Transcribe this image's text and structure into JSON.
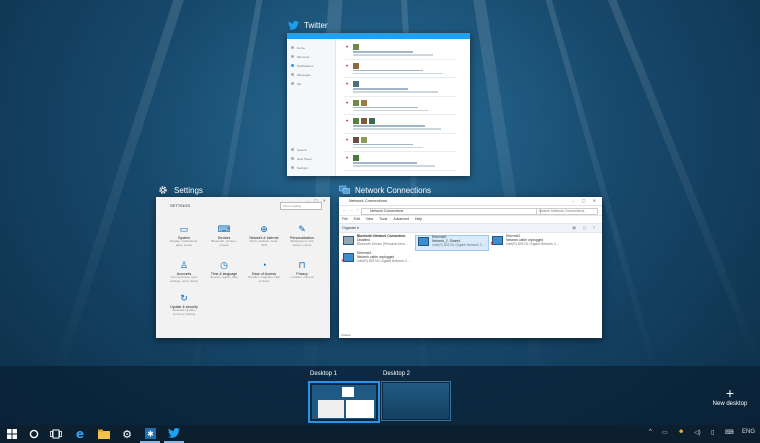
{
  "windows": {
    "twitter": {
      "title": "Twitter",
      "app_bar": "Twitter",
      "nav": [
        "Home",
        "Moments",
        "Notifications",
        "Messages",
        "Me"
      ],
      "nav_bottom": [
        "Search",
        "New Tweet",
        "Settings"
      ]
    },
    "settings": {
      "title": "Settings",
      "heading": "SETTINGS",
      "search_placeholder": "Find a setting",
      "tiles": [
        {
          "name": "System",
          "desc": "Display, notifications, apps, power",
          "icon": "system-icon"
        },
        {
          "name": "Devices",
          "desc": "Bluetooth, printers, mouse",
          "icon": "devices-icon"
        },
        {
          "name": "Network & Internet",
          "desc": "Wi-Fi, airplane mode, VPN",
          "icon": "network-icon"
        },
        {
          "name": "Personalization",
          "desc": "Background, lock screen, colors",
          "icon": "personalization-icon"
        },
        {
          "name": "Accounts",
          "desc": "Your accounts, sync settings, work, family",
          "icon": "accounts-icon"
        },
        {
          "name": "Time & language",
          "desc": "Speech, region, date",
          "icon": "clock-icon"
        },
        {
          "name": "Ease of Access",
          "desc": "Narrator, magnifier, high contrast",
          "icon": "ease-of-access-icon"
        },
        {
          "name": "Privacy",
          "desc": "Location, camera",
          "icon": "lock-icon"
        },
        {
          "name": "Update & security",
          "desc": "Windows Update, recovery, backup",
          "icon": "update-icon"
        }
      ]
    },
    "network": {
      "title": "Network Connections",
      "window_title": "Network Connections",
      "address": "Network Connections",
      "search_placeholder": "Search Network Connections",
      "menu": [
        "File",
        "Edit",
        "View",
        "Tools",
        "Advanced",
        "Help"
      ],
      "organize": "Organize ▾",
      "adapters": [
        {
          "name": "Bluetooth Network Connection",
          "status": "Disabled",
          "device": "Bluetooth Device (Personal Area ...",
          "selected": false
        },
        {
          "name": "Ethernet0",
          "status": "Network_2, Shared",
          "device": "Intel(R) 82574L Gigabit Network C...",
          "selected": true
        },
        {
          "name": "Ethernet1",
          "status": "Network cable unplugged",
          "device": "Intel(R) 82574L Gigabit Network C...",
          "selected": false
        },
        {
          "name": "Ethernet2",
          "status": "Network cable unplugged",
          "device": "Intel(R) 82574L Gigabit Network C...",
          "selected": false
        }
      ],
      "status_bar": "4 items"
    }
  },
  "desktops": [
    {
      "label": "Desktop 1",
      "selected": true
    },
    {
      "label": "Desktop 2",
      "selected": false
    }
  ],
  "new_desktop": {
    "label": "New desktop",
    "icon": "plus-icon"
  },
  "taskbar": {
    "apps": [
      "start-icon",
      "cortana-icon",
      "task-view-icon",
      "edge-icon",
      "file-explorer-icon",
      "settings-icon",
      "network-app-icon",
      "twitter-icon"
    ],
    "language": "ENG"
  },
  "colors": {
    "accent": "#2b93e6",
    "twitter_blue": "#1da1f2",
    "settings_blue": "#0063b1"
  }
}
